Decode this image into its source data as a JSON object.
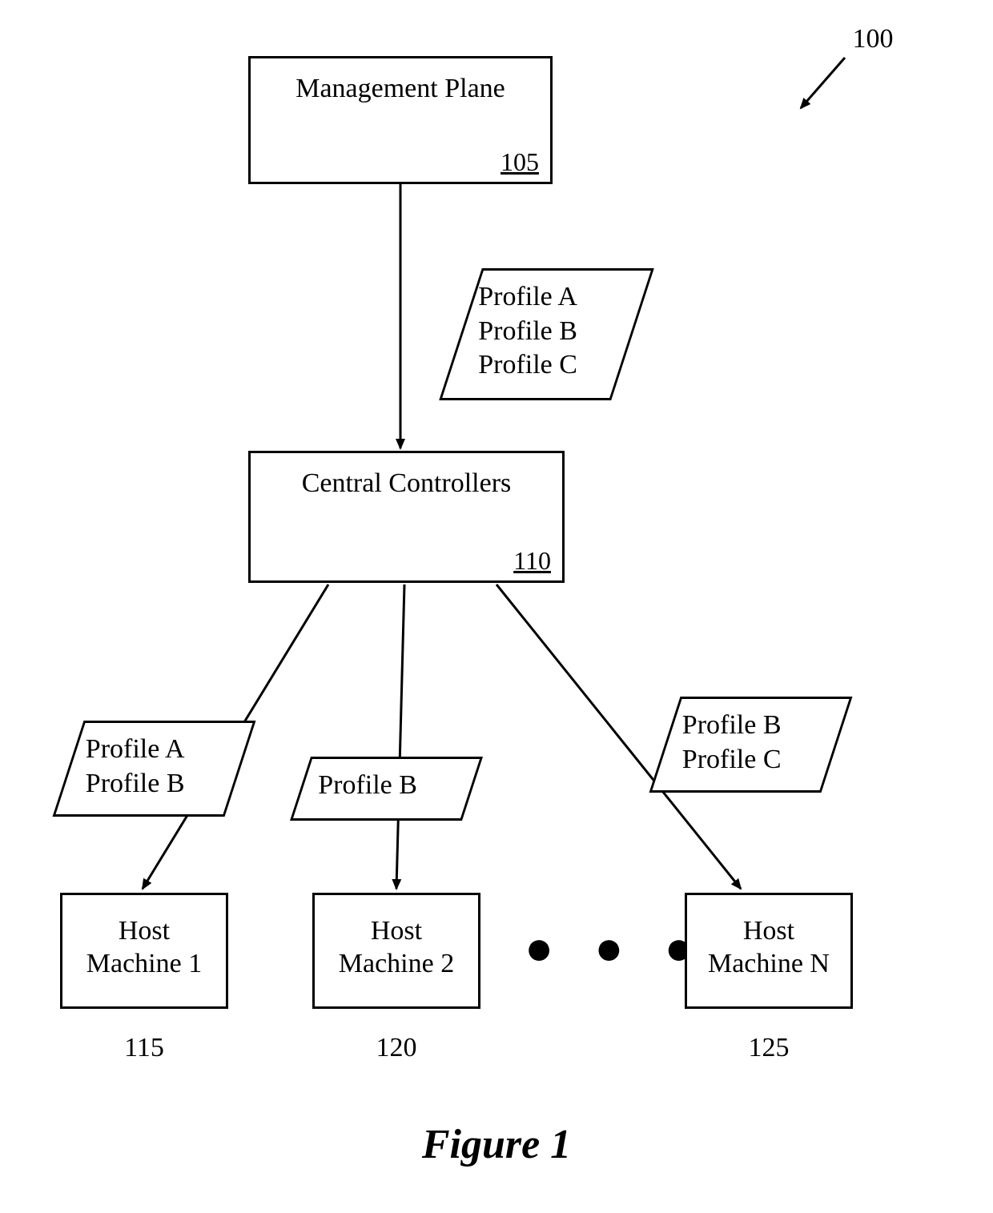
{
  "figure": {
    "number_label": "100",
    "caption": "Figure 1"
  },
  "management_plane": {
    "title": "Management Plane",
    "ref": "105"
  },
  "profiles_all": {
    "lines": {
      "l1": "Profile A",
      "l2": "Profile B",
      "l3": "Profile C"
    }
  },
  "central_controllers": {
    "title": "Central Controllers",
    "ref": "110"
  },
  "host1": {
    "line1": "Host",
    "line2": "Machine 1",
    "ref": "115",
    "profiles": {
      "l1": "Profile A",
      "l2": "Profile B"
    }
  },
  "host2": {
    "line1": "Host",
    "line2": "Machine 2",
    "ref": "120",
    "profiles": {
      "l1": "Profile B"
    }
  },
  "hostN": {
    "line1": "Host",
    "line2": "Machine N",
    "ref": "125",
    "profiles": {
      "l1": "Profile B",
      "l2": "Profile C"
    }
  },
  "ellipsis": "● ● ●"
}
